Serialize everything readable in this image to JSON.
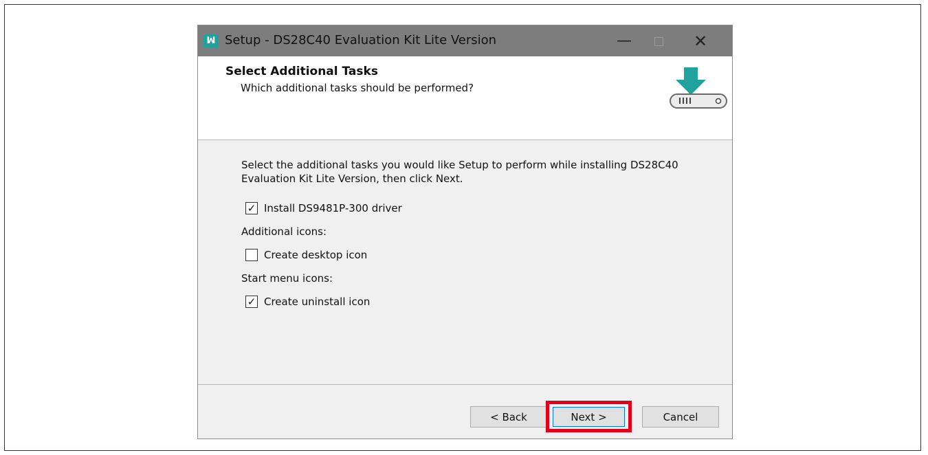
{
  "window": {
    "app_icon_text": "ꟽ",
    "title": "Setup - DS28C40 Evaluation Kit Lite Version",
    "minimize": "—",
    "close": "✕"
  },
  "header": {
    "title": "Select Additional Tasks",
    "subtitle": "Which additional tasks should be performed?",
    "graphic": "download-drive-icon",
    "accent_color": "#20a39e"
  },
  "content": {
    "intro": "Select the additional tasks you would like Setup to perform while installing DS28C40 Evaluation Kit Lite Version, then click Next.",
    "tasks": [
      {
        "label": "Install DS9481P-300 driver",
        "checked": true
      },
      {
        "label": "Create desktop icon",
        "checked": false
      },
      {
        "label": "Create uninstall icon",
        "checked": true
      }
    ],
    "additional_icons_label": "Additional icons:",
    "start_menu_label": "Start menu icons:"
  },
  "buttons": {
    "back": "< Back",
    "next": "Next >",
    "cancel": "Cancel"
  },
  "highlight_color": "#e0001a"
}
